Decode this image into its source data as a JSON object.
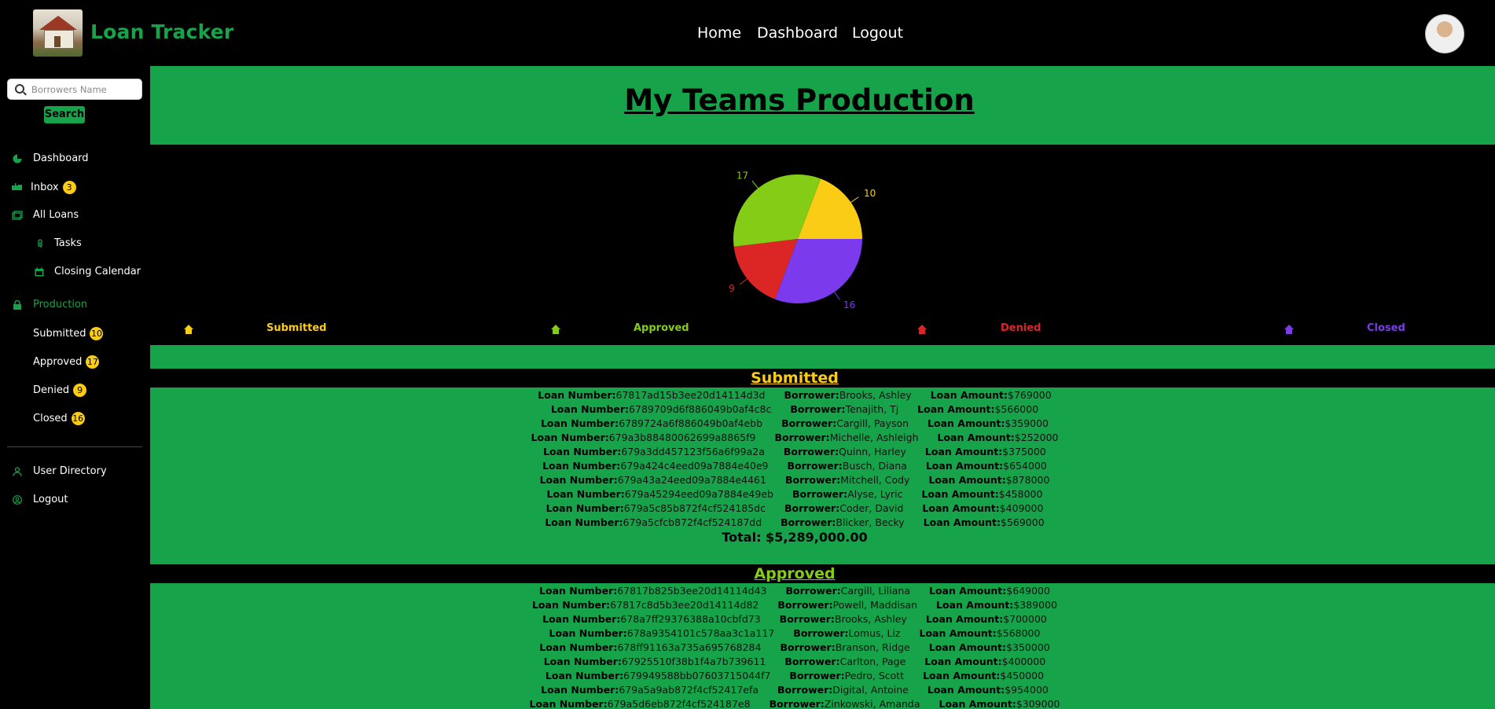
{
  "app": {
    "title": "Loan Tracker"
  },
  "nav": {
    "home": "Home",
    "dashboard": "Dashboard",
    "logout": "Logout"
  },
  "search": {
    "placeholder": "Borrowers Name",
    "button": "Search"
  },
  "sidebar": {
    "dashboard": "Dashboard",
    "inbox": "Inbox",
    "inbox_count": "3",
    "all_loans": "All Loans",
    "tasks": "Tasks",
    "closing_calendar": "Closing Calendar",
    "production": "Production",
    "submitted": "Submitted",
    "submitted_count": "10",
    "approved": "Approved",
    "approved_count": "17",
    "denied": "Denied",
    "denied_count": "9",
    "closed": "Closed",
    "closed_count": "16",
    "user_directory": "User Directory",
    "logout": "Logout"
  },
  "main": {
    "title": "My Teams Production"
  },
  "colors": {
    "brand": "#16a34a",
    "submitted": "#facc15",
    "approved": "#84cc16",
    "denied": "#dc2626",
    "closed": "#7c3aed"
  },
  "chart_data": {
    "type": "pie",
    "labels": [
      "Submitted",
      "Approved",
      "Denied",
      "Closed"
    ],
    "values": [
      10,
      17,
      9,
      16
    ],
    "colors": [
      "#facc15",
      "#84cc16",
      "#dc2626",
      "#7c3aed"
    ],
    "legend": "bottom"
  },
  "labels": {
    "loan_number": "Loan Number:",
    "borrower": "Borrower:",
    "loan_amount": "Loan Amount:"
  },
  "sections": {
    "submitted": {
      "title": "Submitted",
      "total": "Total: $5,289,000.00",
      "rows": [
        {
          "loan": "67817ad15b3ee20d14114d3d",
          "borrower": "Brooks, Ashley",
          "amount": "$769000"
        },
        {
          "loan": "6789709d6f886049b0af4c8c",
          "borrower": "Tenajith, Tj",
          "amount": "$566000"
        },
        {
          "loan": "6789724a6f886049b0af4ebb",
          "borrower": "Cargill, Payson",
          "amount": "$359000"
        },
        {
          "loan": "679a3b88480062699a8865f9",
          "borrower": "Michelle, Ashleigh",
          "amount": "$252000"
        },
        {
          "loan": "679a3dd457123f56a6f99a2a",
          "borrower": "Quinn, Harley",
          "amount": "$375000"
        },
        {
          "loan": "679a424c4eed09a7884e40e9",
          "borrower": "Busch, Diana",
          "amount": "$654000"
        },
        {
          "loan": "679a43a24eed09a7884e4461",
          "borrower": "Mitchell, Cody",
          "amount": "$878000"
        },
        {
          "loan": "679a45294eed09a7884e49eb",
          "borrower": "Alyse, Lyric",
          "amount": "$458000"
        },
        {
          "loan": "679a5c85b872f4cf524185dc",
          "borrower": "Coder, David",
          "amount": "$409000"
        },
        {
          "loan": "679a5cfcb872f4cf524187dd",
          "borrower": "Blicker, Becky",
          "amount": "$569000"
        }
      ]
    },
    "approved": {
      "title": "Approved",
      "rows": [
        {
          "loan": "67817b825b3ee20d14114d43",
          "borrower": "Cargill, Liliana",
          "amount": "$649000"
        },
        {
          "loan": "67817c8d5b3ee20d14114d82",
          "borrower": "Powell, Maddisan",
          "amount": "$389000"
        },
        {
          "loan": "678a7ff29376388a10cbfd73",
          "borrower": "Brooks, Ashley",
          "amount": "$700000"
        },
        {
          "loan": "678a9354101c578aa3c1a117",
          "borrower": "Lomus, Liz",
          "amount": "$568000"
        },
        {
          "loan": "678ff91163a735a695768284",
          "borrower": "Branson, Ridge",
          "amount": "$350000"
        },
        {
          "loan": "67925510f38b1f4a7b739611",
          "borrower": "Carlton, Page",
          "amount": "$400000"
        },
        {
          "loan": "679949588bb07603715044f7",
          "borrower": "Pedro, Scott",
          "amount": "$450000"
        },
        {
          "loan": "679a5a9ab872f4cf52417efa",
          "borrower": "Digital, Antoine",
          "amount": "$954000"
        },
        {
          "loan": "679a5d6eb872f4cf524187e8",
          "borrower": "Zinkowski, Amanda",
          "amount": "$309000"
        }
      ]
    }
  }
}
